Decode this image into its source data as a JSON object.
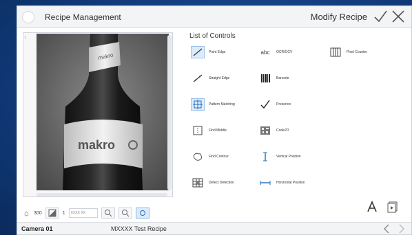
{
  "header": {
    "app_title": "Recipe Management",
    "mode_title": "Modify Recipe",
    "confirm_icon": "check-icon",
    "close_icon": "close-icon"
  },
  "image_panel": {
    "label_brand": "makro",
    "toolbar": {
      "brightness_value": "300",
      "contrast_value": "1",
      "field_placeholder": "XXXX XX"
    }
  },
  "controls": {
    "title": "List of Controls",
    "items": [
      {
        "label": "Point Edge",
        "icon": "point-edge-icon"
      },
      {
        "label": "OCR/OCV",
        "icon": "abc-icon",
        "icon_text": "abc"
      },
      {
        "label": "Pixel Counter",
        "icon": "pixel-counter-icon"
      },
      {
        "label": "Straight Edge",
        "icon": "straight-edge-icon"
      },
      {
        "label": "Barcode",
        "icon": "barcode-icon"
      },
      {
        "label": "Pattern Matching",
        "icon": "pattern-matching-icon"
      },
      {
        "label": "Presence",
        "icon": "check-icon"
      },
      {
        "label": "Find Middle",
        "icon": "find-middle-icon"
      },
      {
        "label": "Code2D",
        "icon": "code2d-icon"
      },
      {
        "label": "Find Contour",
        "icon": "contour-icon"
      },
      {
        "label": "Vertical Position",
        "icon": "vertical-position-icon"
      },
      {
        "label": "Defect Detection",
        "icon": "defect-detection-icon"
      },
      {
        "label": "Horizontal Position",
        "icon": "horizontal-position-icon"
      }
    ]
  },
  "status": {
    "camera": "Camera 01",
    "recipe": "MXXXX Test Recipe"
  },
  "colors": {
    "background": "#123d7e",
    "accent": "#dcebfb",
    "accent_border": "#9dc0e8",
    "icon_blue": "#1f6fbf"
  }
}
